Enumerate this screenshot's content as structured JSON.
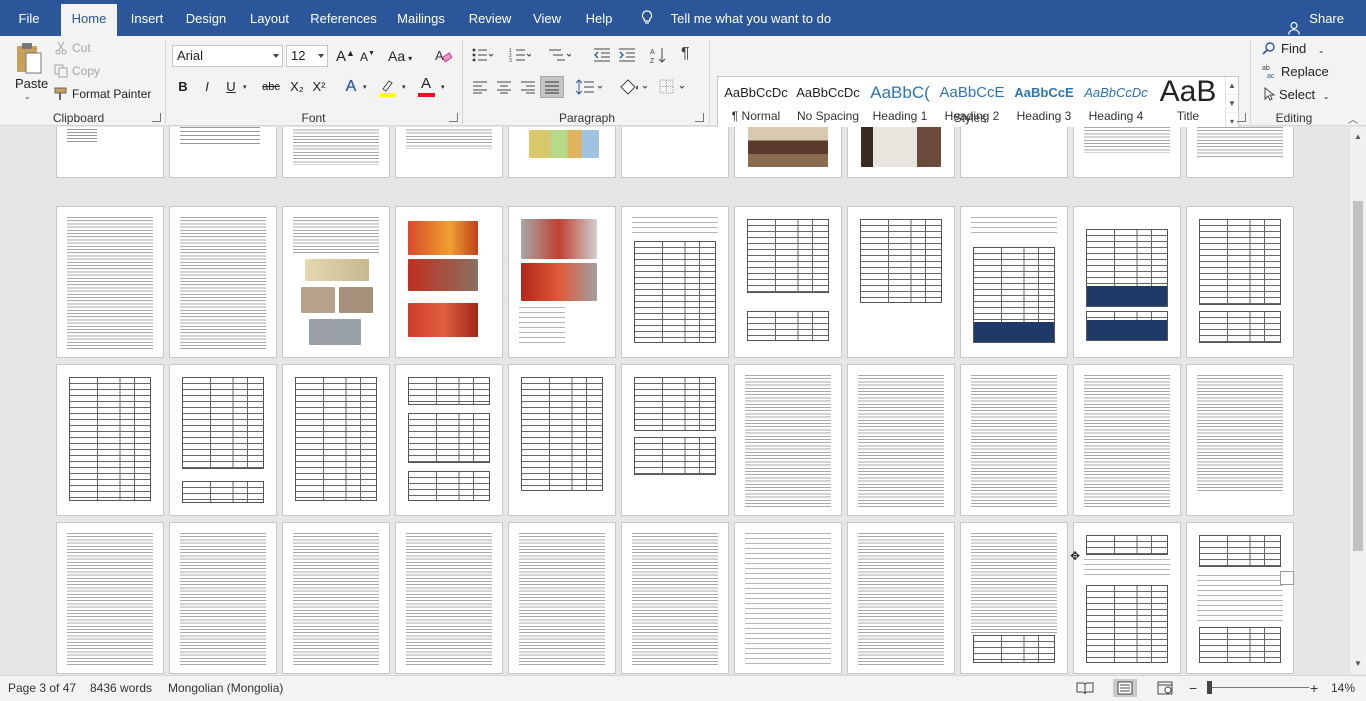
{
  "tabs": [
    {
      "label": "File",
      "active": false
    },
    {
      "label": "Home",
      "active": true
    },
    {
      "label": "Insert",
      "active": false
    },
    {
      "label": "Design",
      "active": false
    },
    {
      "label": "Layout",
      "active": false
    },
    {
      "label": "References",
      "active": false
    },
    {
      "label": "Mailings",
      "active": false
    },
    {
      "label": "Review",
      "active": false
    },
    {
      "label": "View",
      "active": false
    },
    {
      "label": "Help",
      "active": false
    }
  ],
  "tell_me": "Tell me what you want to do",
  "share": "Share",
  "clipboard": {
    "paste": "Paste",
    "cut": "Cut",
    "copy": "Copy",
    "format_painter": "Format Painter",
    "label": "Clipboard"
  },
  "font": {
    "name": "Arial",
    "size": "12",
    "label": "Font",
    "bold": "B",
    "italic": "I",
    "underline": "U",
    "strikethrough": "abc",
    "subscript": "X₂",
    "superscript": "X²",
    "grow": "A",
    "shrink": "A",
    "change_case": "Aa",
    "text_effects": "A",
    "font_color": "A",
    "font_color_hex": "#e81123",
    "highlight_hex": "#ffff00"
  },
  "paragraph": {
    "label": "Paragraph"
  },
  "styles": {
    "label": "Styles",
    "items": [
      {
        "sample": "AaBbCcDc",
        "name": "¶ Normal"
      },
      {
        "sample": "AaBbCcDc",
        "name": "No Spacing"
      },
      {
        "sample": "AaBbC(",
        "name": "Heading 1"
      },
      {
        "sample": "AaBbCcE",
        "name": "Heading 2"
      },
      {
        "sample": "AaBbCcE",
        "name": "Heading 3"
      },
      {
        "sample": "AaBbCcDc",
        "name": "Heading 4"
      },
      {
        "sample": "AaB",
        "name": "Title"
      }
    ]
  },
  "editing": {
    "label": "Editing",
    "find": "Find",
    "replace": "Replace",
    "select": "Select"
  },
  "status": {
    "page": "Page 3 of 47",
    "words": "8436 words",
    "language": "Mongolian (Mongolia)",
    "zoom": "14%",
    "zoom_minus": "−",
    "zoom_plus": "+"
  },
  "colors": {
    "ribbon_blue": "#2b579a",
    "heading_blue": "#2e74b5",
    "table_dark_blue": "#1f3a68"
  }
}
